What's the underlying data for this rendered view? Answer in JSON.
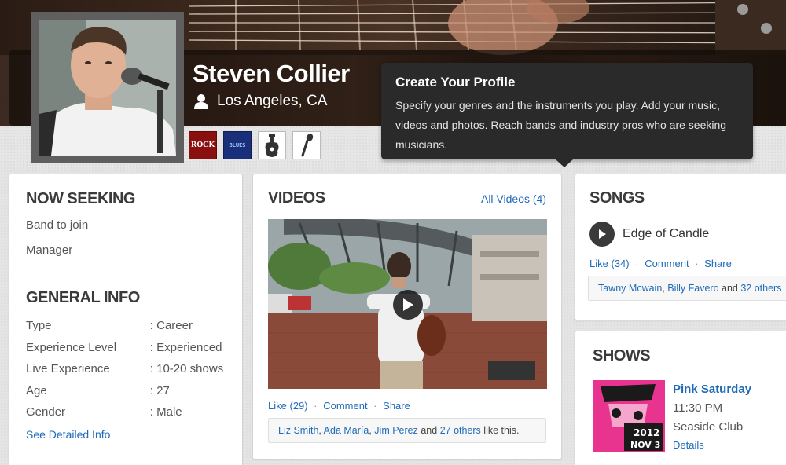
{
  "profile": {
    "name": "Steven Collier",
    "location": "Los Angeles, CA",
    "badges": [
      {
        "label": "ROCK",
        "icon": "rock-genre-badge"
      },
      {
        "label": "BLUES",
        "icon": "blues-genre-badge"
      },
      {
        "label": "",
        "icon": "guitar-icon"
      },
      {
        "label": "",
        "icon": "microphone-icon"
      }
    ]
  },
  "tooltip": {
    "title": "Create Your Profile",
    "body": "Specify your genres and the instruments you play. Add your music,  videos and photos. Reach bands and industry pros who are seeking musicians."
  },
  "seeking": {
    "title": "NOW SEEKING",
    "items": [
      "Band to join",
      "Manager"
    ]
  },
  "general_info": {
    "title": "GENERAL INFO",
    "rows": [
      {
        "key": "Type",
        "value": ": Career"
      },
      {
        "key": "Experience Level",
        "value": ": Experienced"
      },
      {
        "key": "Live Experience",
        "value": ": 10-20 shows"
      },
      {
        "key": "Age",
        "value": ": 27"
      },
      {
        "key": "Gender",
        "value": ": Male"
      }
    ],
    "detail_link": "See Detailed Info"
  },
  "videos": {
    "title": "VIDEOS",
    "all_link": "All Videos (4)",
    "like_label": "Like",
    "like_count": "(29)",
    "comment_label": "Comment",
    "share_label": "Share",
    "likers": [
      "Liz Smith",
      "Ada María",
      "Jim Perez"
    ],
    "others_link": "27 others",
    "and_text": " and ",
    "like_suffix": " like this."
  },
  "songs": {
    "title": "SONGS",
    "song_title": "Edge of Candle",
    "like_label": "Like",
    "like_count": "(34)",
    "comment_label": "Comment",
    "share_label": "Share",
    "likers": [
      "Tawny Mcwain",
      "Billy Favero"
    ],
    "others_link": "32 others",
    "and_text": " and "
  },
  "shows": {
    "title": "SHOWS",
    "show_title": "Pink Saturday",
    "time": "11:30 PM",
    "venue": "Seaside Club",
    "details_link": "Details",
    "poster_year": "2012",
    "poster_date": "NOV 3"
  }
}
